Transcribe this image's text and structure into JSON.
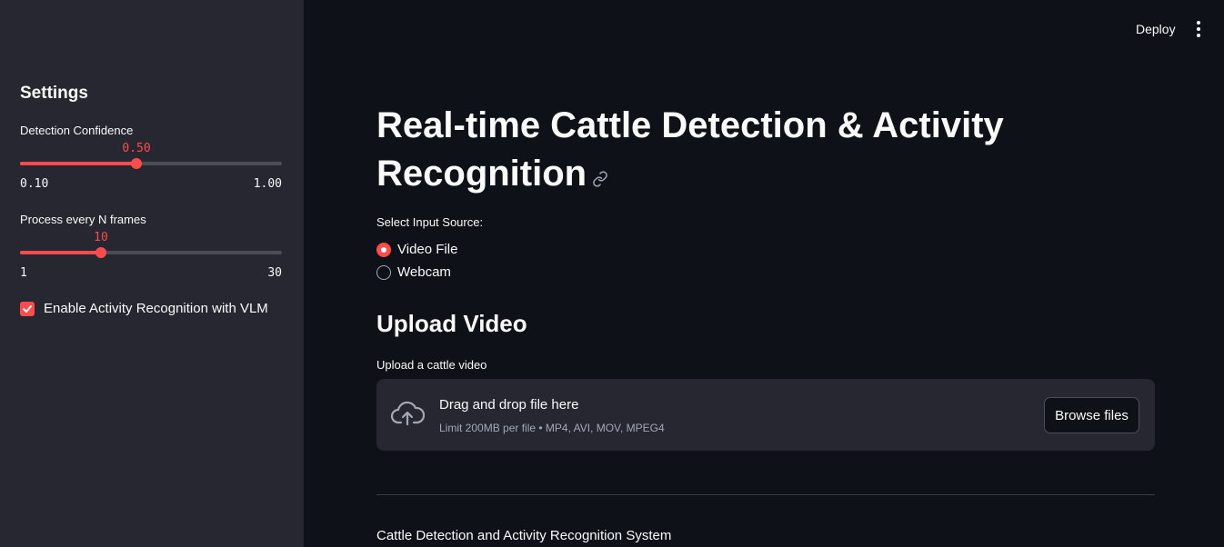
{
  "topbar": {
    "deploy_label": "Deploy",
    "menu_icon": "kebab-menu-icon"
  },
  "sidebar": {
    "title": "Settings",
    "confidence_slider": {
      "label": "Detection Confidence",
      "value": "0.50",
      "min": "0.10",
      "max": "1.00",
      "fraction": 0.444
    },
    "frames_slider": {
      "label": "Process every N frames",
      "value": "10",
      "min": "1",
      "max": "30",
      "fraction": 0.31
    },
    "activity_checkbox": {
      "label": "Enable Activity Recognition with VLM",
      "checked": true
    }
  },
  "main": {
    "title": "Real-time Cattle Detection & Activity Recognition",
    "input_source": {
      "label": "Select Input Source:",
      "options": [
        {
          "label": "Video File",
          "selected": true
        },
        {
          "label": "Webcam",
          "selected": false
        }
      ]
    },
    "upload_heading": "Upload Video",
    "uploader": {
      "label": "Upload a cattle video",
      "drag_text": "Drag and drop file here",
      "limit_text": "Limit 200MB per file • MP4, AVI, MOV, MPEG4",
      "browse_label": "Browse files",
      "icon": "cloud-upload-icon"
    },
    "footer_text": "Cattle Detection and Activity Recognition System"
  },
  "colors": {
    "accent": "#ff4b4b",
    "background": "#0e1117",
    "sidebar": "#262730"
  }
}
